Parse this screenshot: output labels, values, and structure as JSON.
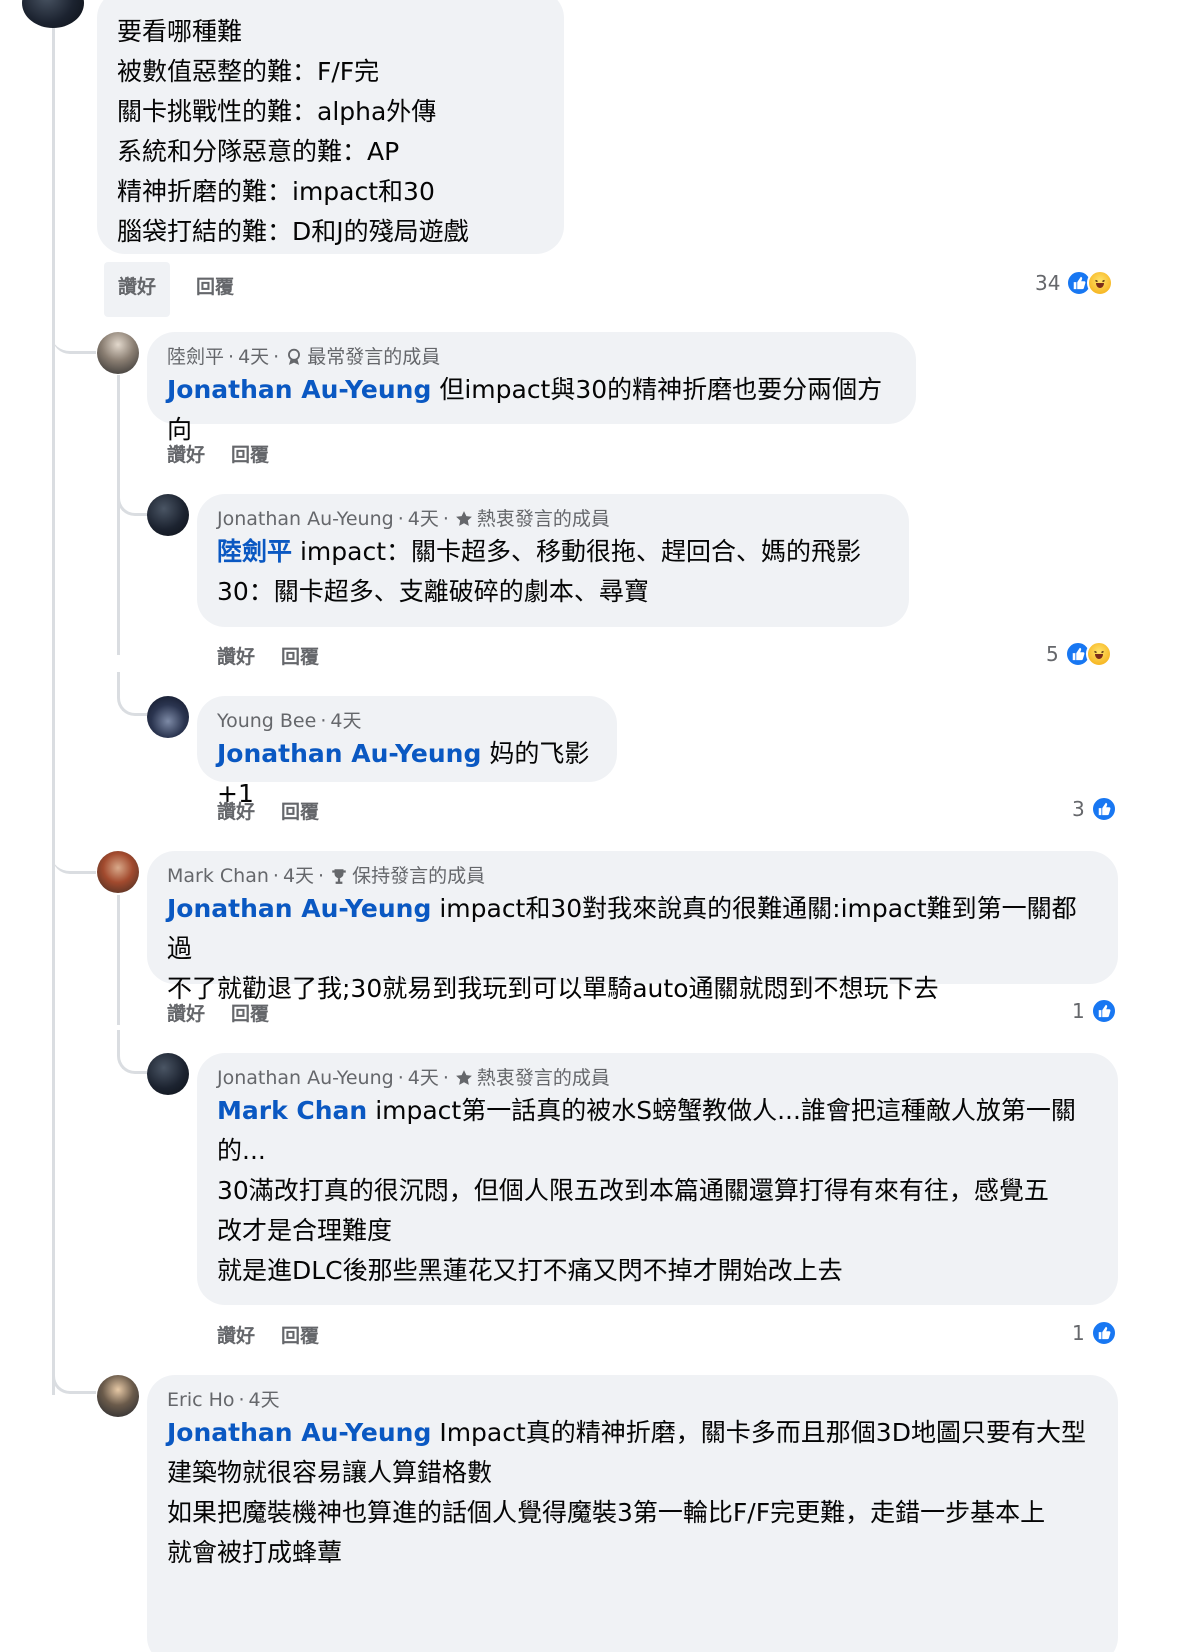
{
  "comments": [
    {
      "lines": [
        "要看哪種難",
        "被數值惡整的難：F/F完",
        "關卡挑戰性的難：alpha外傳",
        "系統和分隊惡意的難：AP",
        "精神折磨的難：impact和30",
        "腦袋打結的難：D和J的殘局遊戲"
      ],
      "like_label": "讚好",
      "reply_label": "回覆",
      "reaction_count": "34"
    },
    {
      "author": "陸劍平",
      "time": "4天",
      "badge": "最常發言的成員",
      "mention": "Jonathan Au-Yeung",
      "text": "但impact與30的精神折磨也要分兩個方向",
      "like_label": "讚好",
      "reply_label": "回覆"
    },
    {
      "author": "Jonathan Au-Yeung",
      "time": "4天",
      "badge": "熱衷發言的成員",
      "mention": "陸劍平",
      "text": "impact：關卡超多、移動很拖、趕回合、媽的飛影",
      "line2": "30：關卡超多、支離破碎的劇本、尋寶",
      "like_label": "讚好",
      "reply_label": "回覆",
      "reaction_count": "5"
    },
    {
      "author": "Young Bee",
      "time": "4天",
      "mention": "Jonathan Au-Yeung",
      "text": "妈的飞影+1",
      "like_label": "讚好",
      "reply_label": "回覆",
      "reaction_count": "3"
    },
    {
      "author": "Mark Chan",
      "time": "4天",
      "badge": "保持發言的成員",
      "mention": "Jonathan Au-Yeung",
      "text": "impact和30對我來說真的很難通關:impact難到第一關都過",
      "line2": "不了就勸退了我;30就易到我玩到可以單騎auto通關就悶到不想玩下去",
      "like_label": "讚好",
      "reply_label": "回覆",
      "reaction_count": "1"
    },
    {
      "author": "Jonathan Au-Yeung",
      "time": "4天",
      "badge": "熱衷發言的成員",
      "mention": "Mark Chan",
      "text": "impact第一話真的被水S螃蟹教做人...誰會把這種敵人放第一關",
      "line2": "的...",
      "line3": "30滿改打真的很沉悶，但個人限五改到本篇通關還算打得有來有往，感覺五",
      "line4": "改才是合理難度",
      "line5": "就是進DLC後那些黑蓮花又打不痛又閃不掉才開始改上去",
      "like_label": "讚好",
      "reply_label": "回覆",
      "reaction_count": "1"
    },
    {
      "author": "Eric Ho",
      "time": "4天",
      "mention": "Jonathan Au-Yeung",
      "text": "Impact真的精神折磨，關卡多而且那個3D地圖只要有大型",
      "line2": "建築物就很容易讓人算錯格數",
      "line3": "如果把魔裝機神也算進的話個人覺得魔裝3第一輪比F/F完更難，走錯一步基本上",
      "line4": "就會被打成蜂蕈"
    }
  ],
  "colors": {
    "mention": "#0a58c2",
    "bubble": "#f0f2f5",
    "like": "#1877f2",
    "meta": "#65676b"
  },
  "icons": {
    "like": "like-reaction-icon",
    "haha": "haha-reaction-icon",
    "award": "award-badge-icon",
    "star": "star-badge-icon"
  }
}
